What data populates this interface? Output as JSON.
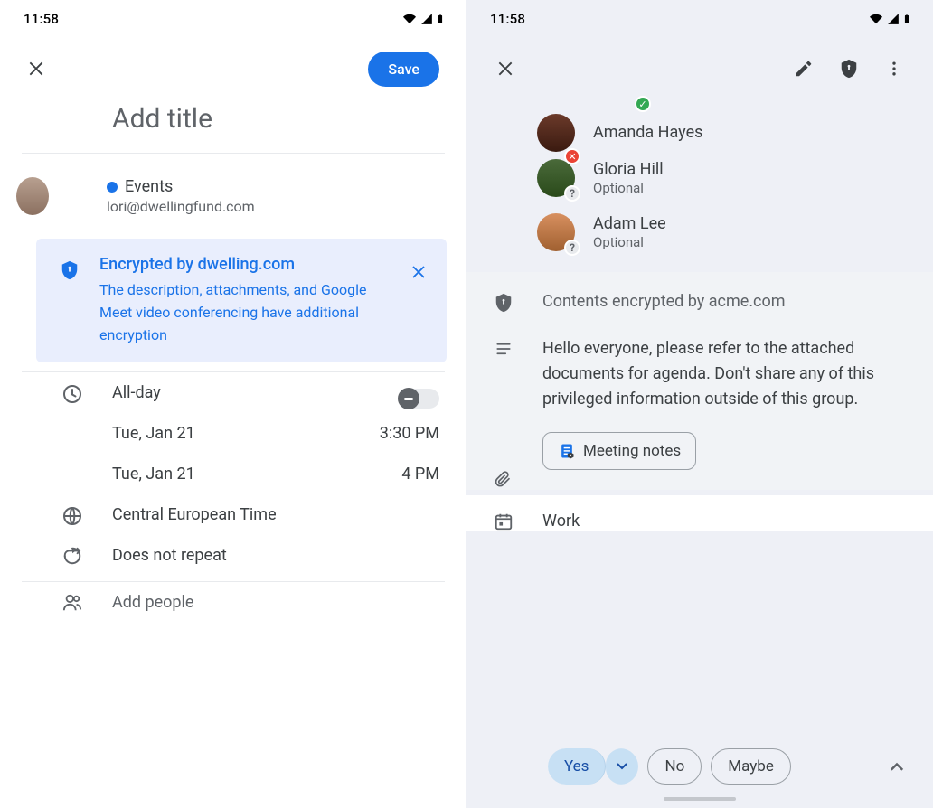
{
  "status": {
    "time": "11:58"
  },
  "left": {
    "save_label": "Save",
    "title_placeholder": "Add title",
    "account": {
      "calendar_name": "Events",
      "email": "lori@dwellingfund.com"
    },
    "encryption": {
      "title": "Encrypted by dwelling.com",
      "body": "The description, attachments, and Google Meet video conferencing have additional encryption"
    },
    "allday_label": "All-day",
    "start_date": "Tue, Jan 21",
    "start_time": "3:30 PM",
    "end_date": "Tue, Jan 21",
    "end_time": "4 PM",
    "timezone": "Central European Time",
    "repeat": "Does not repeat",
    "add_people": "Add people"
  },
  "right": {
    "people": [
      {
        "name": "Amanda Hayes",
        "status": "declined",
        "optional": ""
      },
      {
        "name": "Gloria Hill",
        "status": "awaiting",
        "optional": "Optional"
      },
      {
        "name": "Adam Lee",
        "status": "awaiting",
        "optional": "Optional"
      }
    ],
    "encrypted_by": "Contents encrypted by acme.com",
    "description": "Hello everyone, please refer to the attached documents for agenda. Don't share any of this privileged information outside of this group.",
    "attachment_label": "Meeting notes",
    "calendar_label": "Work",
    "rsvp": {
      "yes": "Yes",
      "no": "No",
      "maybe": "Maybe"
    }
  }
}
